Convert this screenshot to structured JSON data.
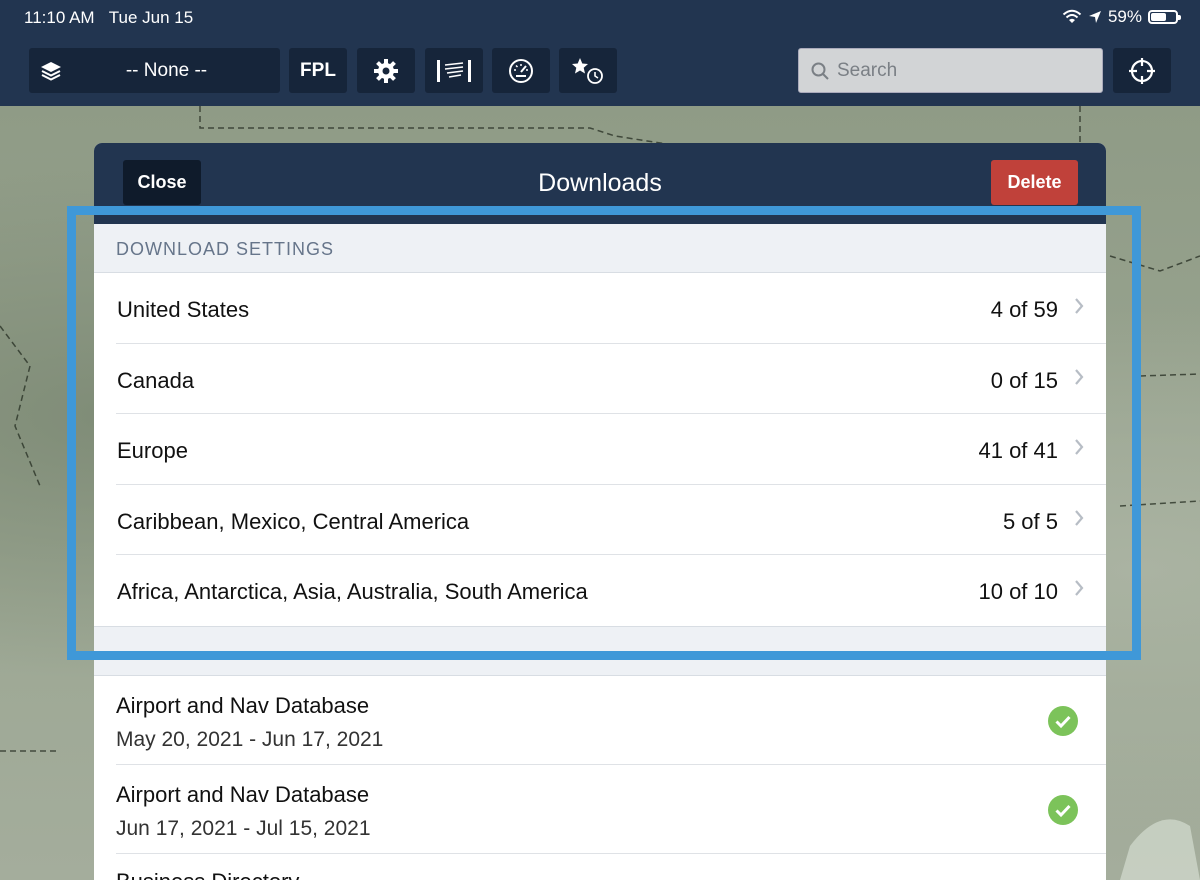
{
  "status_bar": {
    "time": "11:10 AM",
    "date": "Tue Jun 15",
    "battery": "59%",
    "battery_level": 0.59,
    "icons": [
      "wifi-icon",
      "location-arrow-icon",
      "battery-icon"
    ]
  },
  "toolbar": {
    "layer_select": "-- None --",
    "fpl_label": "FPL",
    "icons": [
      "layers-icon",
      "gear-icon",
      "weather-icon",
      "gauge-icon",
      "star-clock-icon",
      "target-icon",
      "search-icon"
    ],
    "search_placeholder": "Search"
  },
  "modal": {
    "title": "Downloads",
    "close_label": "Close",
    "delete_label": "Delete",
    "section_header": "DOWNLOAD SETTINGS",
    "regions": [
      {
        "label": "United States",
        "count": "4 of 59"
      },
      {
        "label": "Canada",
        "count": "0 of 15"
      },
      {
        "label": "Europe",
        "count": "41 of 41"
      },
      {
        "label": "Caribbean, Mexico, Central America",
        "count": "5 of 5"
      },
      {
        "label": "Africa, Antarctica, Asia, Australia, South America",
        "count": "10 of 10"
      }
    ],
    "databases": [
      {
        "name": "Airport and Nav Database",
        "date": "May 20, 2021 - Jun 17, 2021",
        "status": "downloaded"
      },
      {
        "name": "Airport and Nav Database",
        "date": "Jun 17, 2021 - Jul 15, 2021",
        "status": "downloaded"
      },
      {
        "name": "Business Directory",
        "date": ""
      }
    ]
  },
  "colors": {
    "header": "#223550",
    "button_dark": "#0f1b2b",
    "delete": "#c0413a",
    "highlight": "#3f98d8",
    "check": "#7cc35a"
  }
}
